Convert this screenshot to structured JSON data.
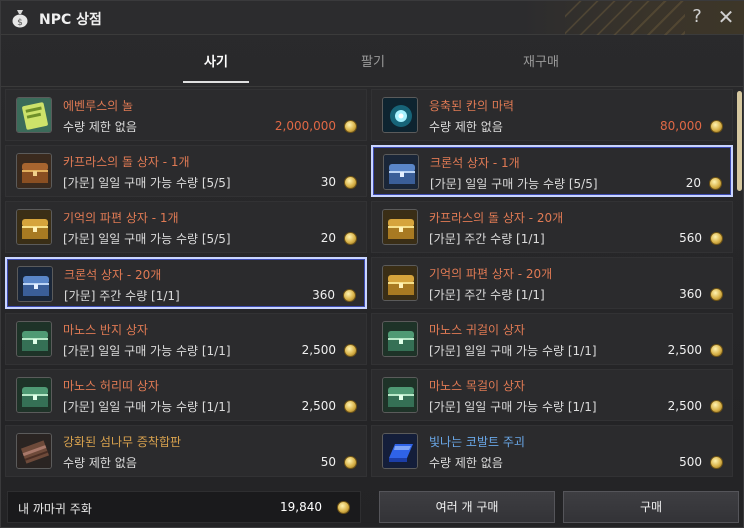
{
  "window": {
    "title": "NPC 상점",
    "help_symbol": "?",
    "close_symbol": "✕",
    "title_icon": "money-bag-icon"
  },
  "tabs": [
    {
      "label": "사기",
      "active": true
    },
    {
      "label": "팔기",
      "active": false
    },
    {
      "label": "재구매",
      "active": false
    }
  ],
  "items": [
    {
      "name": "에벤루스의 놀",
      "desc": "수량 제한 없음",
      "price": "2,000,000",
      "name_color": "red",
      "price_color": "red",
      "icon": "green-scroll-icon",
      "highlighted": false
    },
    {
      "name": "응축된 칸의 마력",
      "desc": "수량 제한 없음",
      "price": "80,000",
      "name_color": "red",
      "price_color": "red",
      "icon": "blue-energy-orb-icon",
      "highlighted": false
    },
    {
      "name": "카프라스의 돌 상자 - 1개",
      "desc": "[가문] 일일 구매 가능 수량 [5/5]",
      "price": "30",
      "name_color": "red",
      "price_color": "white",
      "icon": "bronze-chest-icon",
      "highlighted": false
    },
    {
      "name": "크론석 상자 - 1개",
      "desc": "[가문] 일일 구매 가능 수량 [5/5]",
      "price": "20",
      "name_color": "red",
      "price_color": "white",
      "icon": "blue-chest-icon",
      "highlighted": true
    },
    {
      "name": "기억의 파편 상자 - 1개",
      "desc": "[가문] 일일 구매 가능 수량 [5/5]",
      "price": "20",
      "name_color": "red",
      "price_color": "white",
      "icon": "gold-chest-icon",
      "highlighted": false
    },
    {
      "name": "카프라스의 돌 상자 - 20개",
      "desc": "[가문] 주간 수량 [1/1]",
      "price": "560",
      "name_color": "red",
      "price_color": "white",
      "icon": "gold-chest-icon",
      "highlighted": false
    },
    {
      "name": "크론석 상자 - 20개",
      "desc": "[가문] 주간 수량 [1/1]",
      "price": "360",
      "name_color": "red",
      "price_color": "white",
      "icon": "blue-chest-icon",
      "highlighted": true
    },
    {
      "name": "기억의 파편 상자 - 20개",
      "desc": "[가문] 주간 수량 [1/1]",
      "price": "360",
      "name_color": "red",
      "price_color": "white",
      "icon": "gold-chest-icon",
      "highlighted": false
    },
    {
      "name": "마노스 반지 상자",
      "desc": "[가문] 일일 구매 가능 수량 [1/1]",
      "price": "2,500",
      "name_color": "red",
      "price_color": "white",
      "icon": "green-chest-icon",
      "highlighted": false
    },
    {
      "name": "마노스 귀걸이 상자",
      "desc": "[가문] 일일 구매 가능 수량 [1/1]",
      "price": "2,500",
      "name_color": "red",
      "price_color": "white",
      "icon": "green-chest-icon",
      "highlighted": false
    },
    {
      "name": "마노스 허리띠 상자",
      "desc": "[가문] 일일 구매 가능 수량 [1/1]",
      "price": "2,500",
      "name_color": "red",
      "price_color": "white",
      "icon": "green-chest-icon",
      "highlighted": false
    },
    {
      "name": "마노스 목걸이 상자",
      "desc": "[가문] 일일 구매 가능 수량 [1/1]",
      "price": "2,500",
      "name_color": "red",
      "price_color": "white",
      "icon": "green-chest-icon",
      "highlighted": false
    },
    {
      "name": "강화된 섬나무 증착합판",
      "desc": "수량 제한 없음",
      "price": "50",
      "name_color": "gold",
      "price_color": "white",
      "icon": "plank-icon",
      "highlighted": false
    },
    {
      "name": "빛나는 코발트 주괴",
      "desc": "수량 제한 없음",
      "price": "500",
      "name_color": "blue",
      "price_color": "white",
      "icon": "cobalt-ingot-icon",
      "highlighted": false
    }
  ],
  "footer": {
    "wallet_label": "내 까마귀 주화",
    "wallet_amount": "19,840",
    "multi_buy_label": "여러 개 구매",
    "buy_label": "구매"
  }
}
